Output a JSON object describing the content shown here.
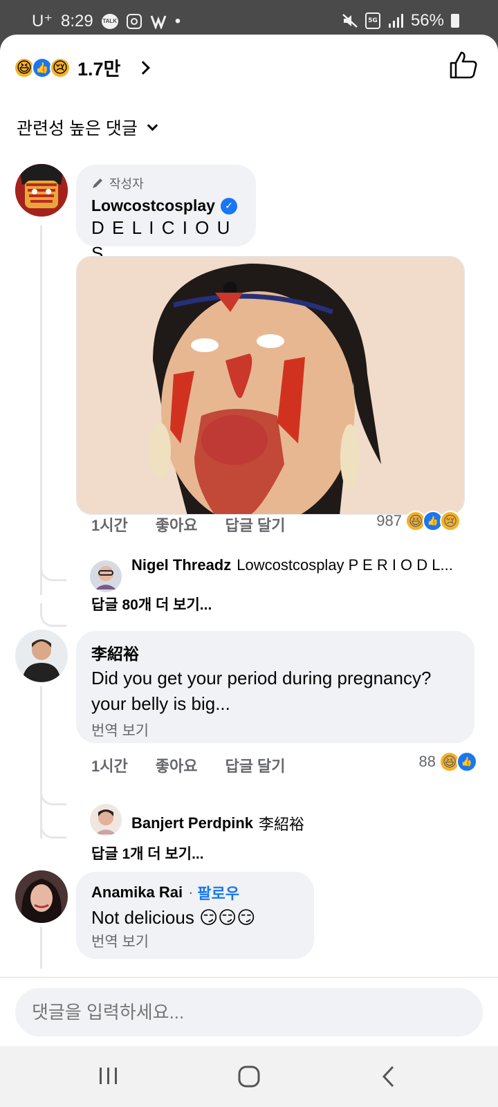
{
  "status_bar": {
    "carrier": "U⁺",
    "time": "8:29",
    "dot": "•",
    "kakao_badge": "TALK",
    "battery": "56%"
  },
  "reactions_summary": {
    "count": "1.7만",
    "icons": [
      "haha-icon",
      "like-icon",
      "sad-icon"
    ]
  },
  "sort_label": "관련성 높은 댓글",
  "comments": [
    {
      "author_tag": "작성자",
      "author": "Lowcostcosplay",
      "verified": true,
      "text": "D E L I C I O U S",
      "meta": {
        "time": "1시간",
        "like": "좋아요",
        "reply": "답글 달기"
      },
      "reaction_count": "987",
      "reply_preview": {
        "name": "Nigel Threadz",
        "text": "Lowcostcosplay P E R I O D L..."
      },
      "more_replies": "답글 80개 더 보기..."
    },
    {
      "author": "李紹裕",
      "text": "Did you get your period during pregnancy? your belly is big...",
      "translate": "번역 보기",
      "meta": {
        "time": "1시간",
        "like": "좋아요",
        "reply": "답글 달기"
      },
      "reaction_count": "88",
      "reply_preview": {
        "name": "Banjert Perdpink",
        "text": "李紹裕"
      },
      "more_replies": "답글 1개 더 보기..."
    },
    {
      "author": "Anamika Rai",
      "separator": "·",
      "follow": "팔로우",
      "text": "Not delicious 😏😏😏",
      "translate": "번역 보기"
    }
  ],
  "input": {
    "placeholder": "댓글을 입력하세요..."
  },
  "colors": {
    "accent": "#1877f2",
    "bubble": "#f0f2f5",
    "secondary_text": "#65676b"
  }
}
